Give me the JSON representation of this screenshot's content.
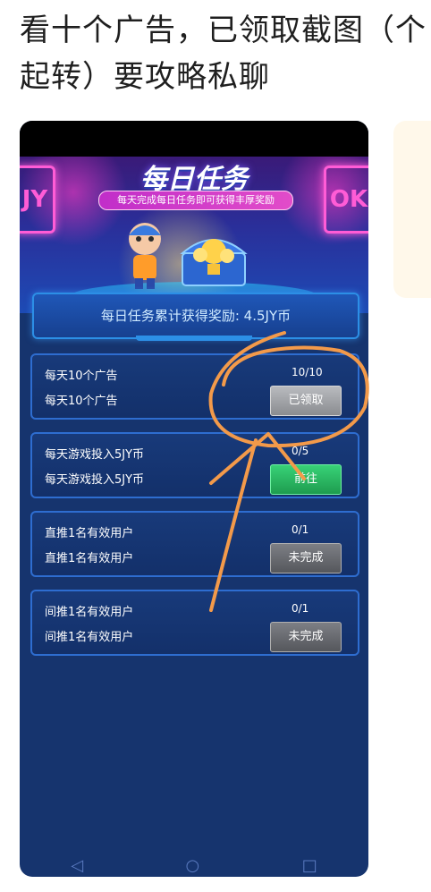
{
  "post": {
    "text": "看十个广告，已领取截图（个起转）要攻略私聊"
  },
  "banner": {
    "title": "每日任务",
    "subtitle": "每天完成每日任务即可获得丰厚奖励",
    "neon_left": "JY",
    "neon_right": "OK"
  },
  "summary": {
    "text": "每日任务累计获得奖励: 4.5JY币"
  },
  "tasks": [
    {
      "title": "每天10个广告",
      "subtitle": "每天10个广告",
      "progress": "10/10",
      "button": "已领取",
      "state": "claimed"
    },
    {
      "title": "每天游戏投入5JY币",
      "subtitle": "每天游戏投入5JY币",
      "progress": "0/5",
      "button": "前往",
      "state": "go"
    },
    {
      "title": "直推1名有效用户",
      "subtitle": "直推1名有效用户",
      "progress": "0/1",
      "button": "未完成",
      "state": "incomplete"
    },
    {
      "title": "间推1名有效用户",
      "subtitle": "间推1名有效用户",
      "progress": "0/1",
      "button": "未完成",
      "state": "incomplete"
    }
  ],
  "nav": {
    "back_icon": "◁",
    "home_icon": "○",
    "recent_icon": "□"
  },
  "colors": {
    "annotation": "#f39a4a",
    "phone_bg": "#16346e"
  }
}
